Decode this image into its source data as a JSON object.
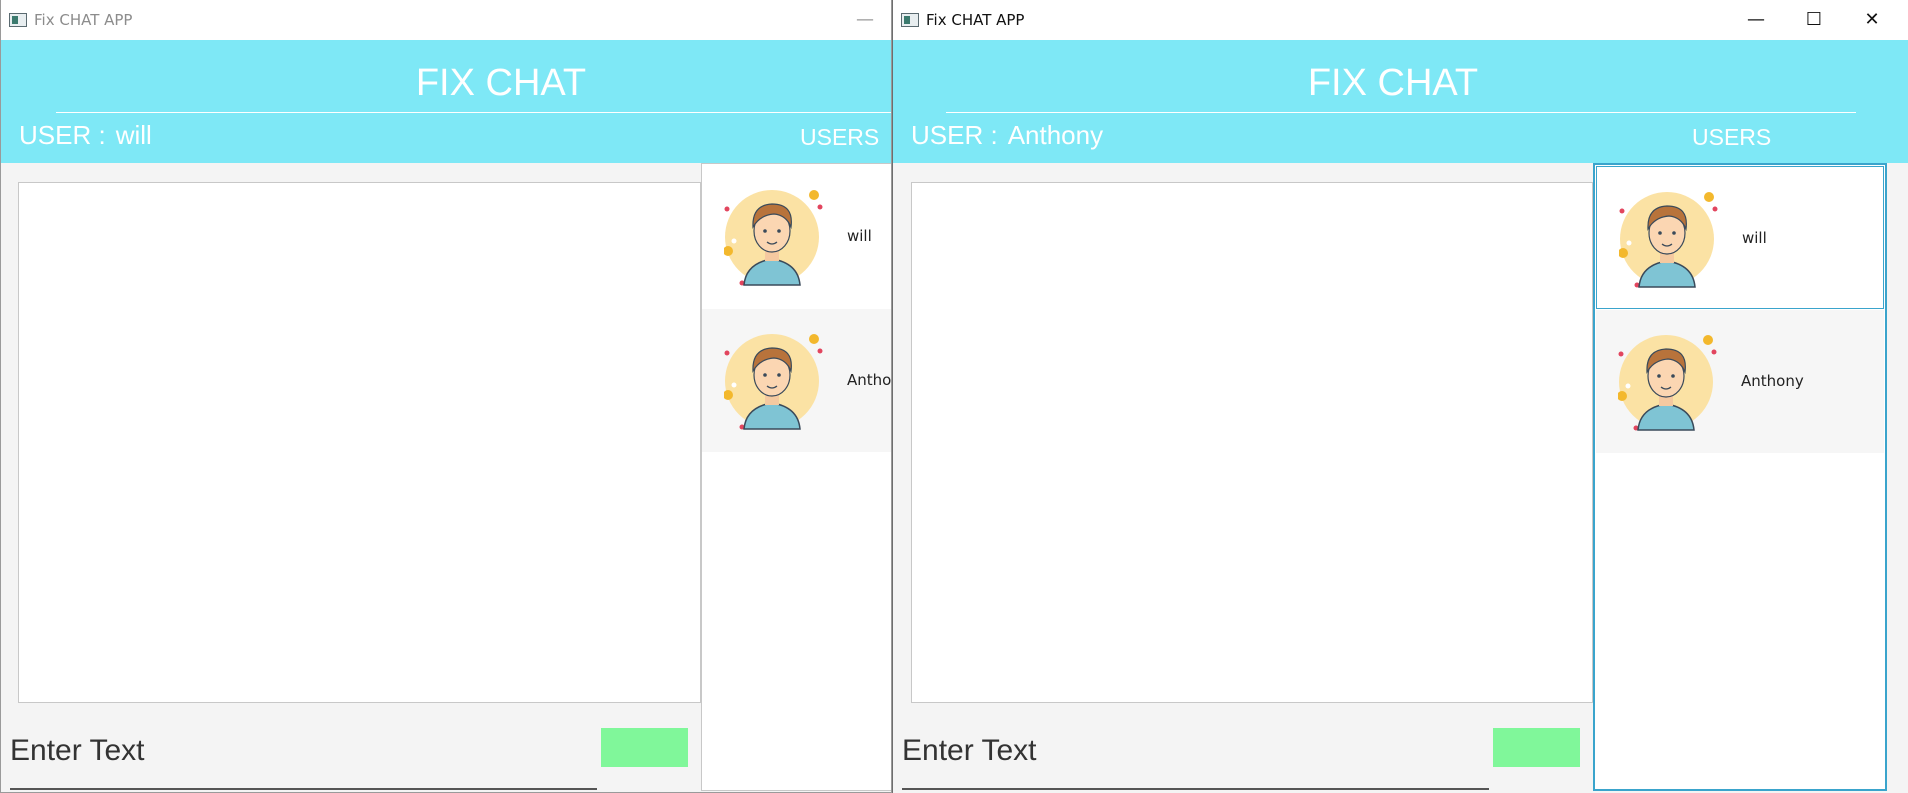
{
  "windows": {
    "left": {
      "title": "Fix CHAT APP",
      "controls": {
        "minimize": "—"
      },
      "app_title": "FIX CHAT",
      "user_label": "USER :",
      "user_name": "will",
      "users_heading": "USERS",
      "users": [
        {
          "name": "will",
          "avatar": "boy-avatar-icon"
        },
        {
          "name": "Anthony",
          "avatar": "boy-avatar-icon"
        }
      ],
      "input_placeholder": "Enter Text"
    },
    "right": {
      "title": "Fix CHAT APP",
      "controls": {
        "minimize": "—",
        "maximize": "☐",
        "close": "✕"
      },
      "app_title": "FIX CHAT",
      "user_label": "USER :",
      "user_name": "Anthony",
      "users_heading": "USERS",
      "users": [
        {
          "name": "will",
          "avatar": "boy-avatar-icon"
        },
        {
          "name": "Anthony",
          "avatar": "boy-avatar-icon"
        }
      ],
      "input_placeholder": "Enter Text"
    }
  },
  "colors": {
    "header": "#7ee8f6",
    "send_button": "#80f79a",
    "selection_border": "#3aa4cc"
  }
}
